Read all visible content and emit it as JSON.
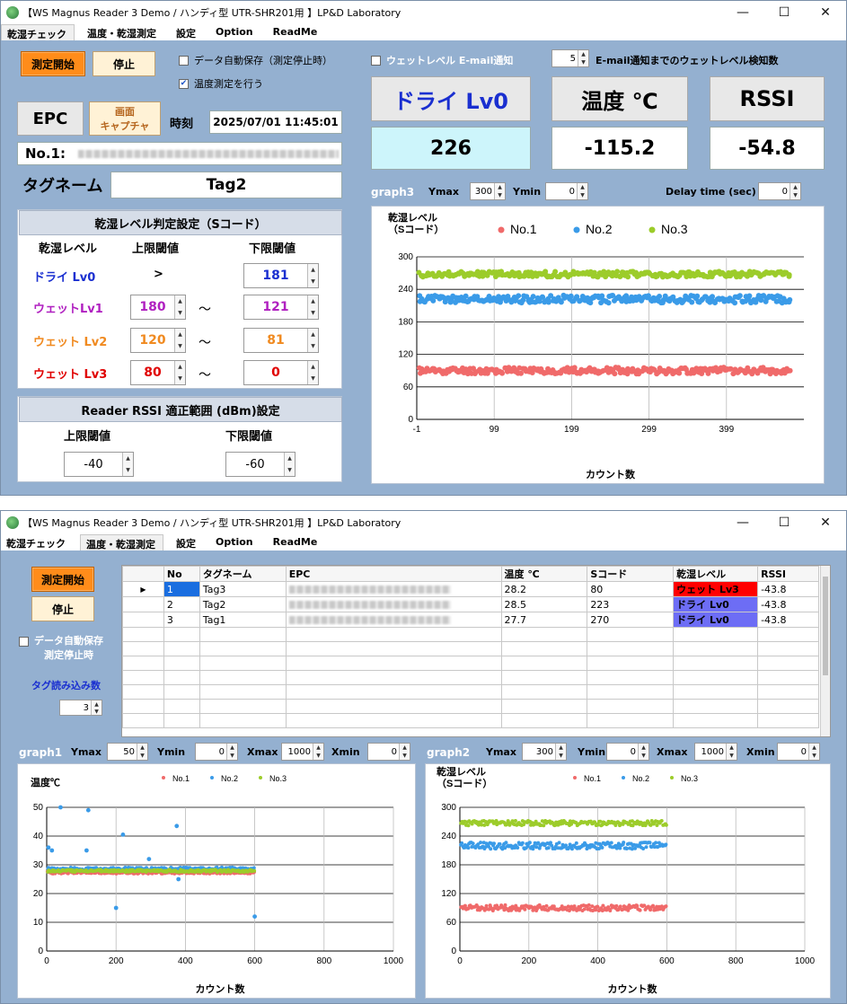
{
  "window": {
    "title": "【WS Magnus Reader  3 Demo / ハンディ型 UTR-SHR201用 】LP&D Laboratory",
    "controls": [
      "—",
      "☐",
      "✕"
    ]
  },
  "menu": [
    "乾湿チェック",
    "温度・乾湿測定",
    "設定",
    "Option",
    "ReadMe"
  ],
  "top": {
    "start_btn": "測定開始",
    "stop_btn": "停止",
    "auto_save": "データ自動保存（測定停止時）",
    "temp_measure": "温度測定を行う",
    "wet_email": "ウェットレベル E-mail通知",
    "email_count_val": "5",
    "email_count_label": "E-mail通知までのウェットレベル検知数",
    "epc_btn": "EPC",
    "capture_btn_1": "画面",
    "capture_btn_2": "キャプチャ",
    "time_label": "時刻",
    "time_value": "2025/07/01 11:45:01",
    "no_label": "No.1:",
    "tagname_label": "タグネーム",
    "tagname_value": "Tag2",
    "level_header": "ドライ Lv0",
    "level_value": "226",
    "temp_header": "温度 ℃",
    "temp_value": "-115.2",
    "rssi_header": "RSSI",
    "rssi_value": "-54.8",
    "judge_title": "乾湿レベル判定設定（Sコード）",
    "col_level": "乾湿レベル",
    "col_upper": "上限閾値",
    "col_lower": "下限閾値",
    "levels": [
      {
        "name": "ドライ Lv0",
        "upper": ">",
        "sep": "",
        "lower": "181",
        "color": "#1a2fd0"
      },
      {
        "name": "ウェットLv1",
        "upper": "180",
        "sep": "～",
        "lower": "121",
        "color": "#b020c0"
      },
      {
        "name": "ウェット Lv2",
        "upper": "120",
        "sep": "～",
        "lower": "81",
        "color": "#f08a20"
      },
      {
        "name": "ウェット Lv3",
        "upper": "80",
        "sep": "～",
        "lower": "0",
        "color": "#e00000"
      }
    ],
    "rssi_title": "Reader RSSI 適正範囲 (dBm)設定",
    "rssi_upper_label": "上限閾値",
    "rssi_lower_label": "下限閾値",
    "rssi_upper": "-40",
    "rssi_lower": "-60",
    "graph3_label": "graph3",
    "ymax_label": "Ymax",
    "ymax": "300",
    "ymin_label": "Ymin",
    "ymin": "0",
    "delay_label": "Delay time (sec)",
    "delay": "0"
  },
  "bottom": {
    "start_btn": "測定開始",
    "stop_btn": "停止",
    "auto_save_1": "データ自動保存",
    "auto_save_2": "測定停止時",
    "tag_count_label": "タグ読み込み数",
    "tag_count": "3",
    "table_headers": [
      "No",
      "タグネーム",
      "EPC",
      "温度 ℃",
      "Sコード",
      "乾湿レベル",
      "RSSI"
    ],
    "rows": [
      {
        "no": "1",
        "tag": "Tag3",
        "temp": "28.2",
        "s": "80",
        "level": "ウェット Lv3",
        "rssi": "-43.8",
        "level_color": "#ff0000"
      },
      {
        "no": "2",
        "tag": "Tag2",
        "temp": "28.5",
        "s": "223",
        "level": "ドライ Lv0",
        "rssi": "-43.8",
        "level_color": "#6d6df5"
      },
      {
        "no": "3",
        "tag": "Tag1",
        "temp": "27.7",
        "s": "270",
        "level": "ドライ Lv0",
        "rssi": "-43.8",
        "level_color": "#6d6df5"
      }
    ],
    "graph1": {
      "label": "graph1",
      "ymax": "50",
      "ymin": "0",
      "xmax": "1000",
      "xmin": "0"
    },
    "graph2": {
      "label": "graph2",
      "ymax": "300",
      "ymin": "0",
      "xmax": "1000",
      "xmin": "0"
    },
    "lbl_ymax": "Ymax",
    "lbl_ymin": "Ymin",
    "lbl_xmax": "Xmax",
    "lbl_xmin": "Xmin"
  },
  "chart_data": [
    {
      "type": "scatter",
      "ylabel": "乾湿レベル\n（Sコード）",
      "xlabel": "カウント数",
      "legend": [
        "No.1",
        "No.2",
        "No.3"
      ],
      "colors": [
        "#f06a6a",
        "#3a9be8",
        "#9ccc2a"
      ],
      "xticks": [
        "-1",
        "99",
        "199",
        "299",
        "399"
      ],
      "xlim": [
        -1,
        499
      ],
      "ylim": [
        0,
        300
      ],
      "yticks": [
        0,
        60,
        120,
        180,
        240,
        300
      ],
      "series": [
        {
          "name": "No.1",
          "center": 90,
          "spread": 6
        },
        {
          "name": "No.2",
          "center": 222,
          "spread": 7
        },
        {
          "name": "No.3",
          "center": 268,
          "spread": 5
        }
      ]
    },
    {
      "type": "scatter",
      "ylabel": "温度℃",
      "xlabel": "カウント数",
      "legend": [
        "No.1",
        "No.2",
        "No.3"
      ],
      "colors": [
        "#f06a6a",
        "#3a9be8",
        "#9ccc2a"
      ],
      "xlim": [
        0,
        1000
      ],
      "ylim": [
        0,
        50
      ],
      "yticks": [
        0,
        10,
        20,
        30,
        40,
        50
      ],
      "xticks": [
        0,
        200,
        400,
        600,
        800,
        1000
      ],
      "series": [
        {
          "name": "No.1",
          "center": 27.3,
          "spread": 0.4
        },
        {
          "name": "No.2",
          "center": 28.6,
          "spread": 0.5
        },
        {
          "name": "No.3",
          "center": 27.9,
          "spread": 0.4
        }
      ],
      "outliers": [
        [
          5,
          36
        ],
        [
          15,
          35
        ],
        [
          40,
          50
        ],
        [
          120,
          49
        ],
        [
          115,
          35
        ],
        [
          200,
          15
        ],
        [
          220,
          40.5
        ],
        [
          295,
          32
        ],
        [
          375,
          43.5
        ],
        [
          380,
          25
        ],
        [
          600,
          12
        ]
      ]
    },
    {
      "type": "scatter",
      "ylabel": "乾湿レベル\n（Sコード）",
      "xlabel": "カウント数",
      "legend": [
        "No.1",
        "No.2",
        "No.3"
      ],
      "colors": [
        "#f06a6a",
        "#3a9be8",
        "#9ccc2a"
      ],
      "xlim": [
        0,
        1000
      ],
      "ylim": [
        0,
        300
      ],
      "yticks": [
        0,
        60,
        120,
        180,
        240,
        300
      ],
      "xticks": [
        0,
        200,
        400,
        600,
        800,
        1000
      ],
      "series": [
        {
          "name": "No.1",
          "center": 90,
          "spread": 6
        },
        {
          "name": "No.2",
          "center": 220,
          "spread": 7
        },
        {
          "name": "No.3",
          "center": 267,
          "spread": 5
        }
      ]
    }
  ]
}
